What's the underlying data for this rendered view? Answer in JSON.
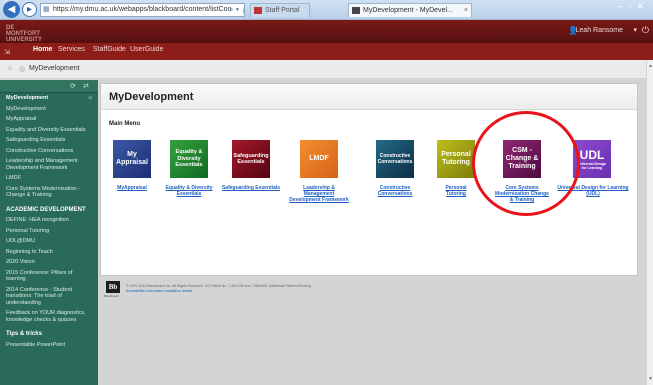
{
  "browser": {
    "url": "https://my.dmu.ac.uk/webapps/blackboard/content/listCon",
    "address_icons": "⌕ ▾ 🔒 C ✕",
    "tabs": [
      {
        "label": "Staff Portal"
      },
      {
        "label": "MyDevelopment - MyDevel..."
      }
    ]
  },
  "header": {
    "logo_text": "DE MONTFORT UNIVERSITY",
    "user_name": "Leah Ransome"
  },
  "nav": {
    "tabs": [
      {
        "label": "Home"
      },
      {
        "label": "Services"
      },
      {
        "label": "StaffGuide"
      },
      {
        "label": "UserGuide"
      }
    ]
  },
  "breadcrumb": {
    "current": "MyDevelopment"
  },
  "sidebar": {
    "items": [
      {
        "label": "MyDevelopment"
      },
      {
        "label": "MyDevelopment"
      },
      {
        "label": "MyAppraisal"
      },
      {
        "label": "Equality and Diversity Essentials"
      },
      {
        "label": "Safeguarding Essentials"
      },
      {
        "label": "Constructive Conversations"
      },
      {
        "label": "Leadership and Management Development Framework"
      },
      {
        "label": "LMDF"
      },
      {
        "label": "Core Systems Modernisation - Change & Training"
      },
      {
        "label": "ACADEMIC DEVELOPMENT"
      },
      {
        "label": "DEFINE: HEA recognition"
      },
      {
        "label": "Personal Tutoring"
      },
      {
        "label": "UDL@DMU"
      },
      {
        "label": "Beginning to Teach"
      },
      {
        "label": "2020 Vision"
      },
      {
        "label": "2015 Conference: Pillars of learning"
      },
      {
        "label": "2014 Conference - Student transitions: The triad of understanding"
      },
      {
        "label": "Feedback on YOUR diagnostics, knowledge checks & quizzes"
      },
      {
        "label": "Tips & tricks"
      },
      {
        "label": "Presentable PowerPoint"
      }
    ]
  },
  "main": {
    "title": "MyDevelopment",
    "menu_label": "Main Menu",
    "tiles": [
      {
        "image_text": "My Appraisal",
        "link": "MyAppraisal"
      },
      {
        "image_text": "Equality & Diversity Essentials",
        "link": "Equality & Diversity Essentials"
      },
      {
        "image_text": "Safeguarding Essentials",
        "link": "Safeguarding Essentials"
      },
      {
        "image_text": "LMDF",
        "link": "Leadership & Management Development Framework"
      },
      {
        "image_text": "Constructive Conversations",
        "link": "Constructive Conversations"
      },
      {
        "image_text": "Personal Tutoring",
        "link": "Personal Tutoring"
      },
      {
        "image_text": "CSM - Change & Training",
        "link": "Core Systems Modernisation Change & Training"
      },
      {
        "image_text": "UDL",
        "image_subtext": "Universal Design for Learning",
        "link": "Universal Design for Learning (UDL)"
      }
    ]
  },
  "footer": {
    "logo_text": "Bb",
    "logo_caption": "Blackboard",
    "copyright": "© 1997-2014 Blackboard Inc. All Rights Reserved. US Patent No. 7,493,396 and 7,558,853. Additional Patents Pending.",
    "links": "Accessibility information    Installation details"
  }
}
